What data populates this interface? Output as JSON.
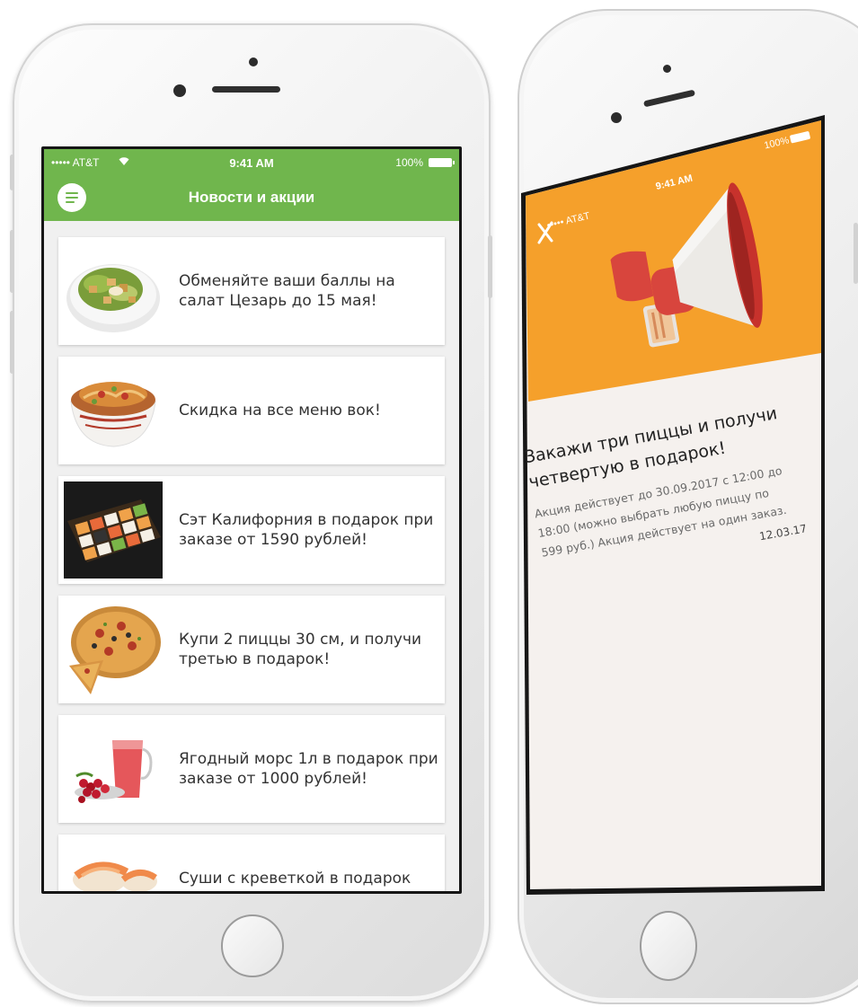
{
  "left_phone": {
    "status_bar": {
      "carrier": "••••• AT&T",
      "time": "9:41 AM",
      "battery": "100%"
    },
    "header": {
      "title": "Новости и акции"
    },
    "news": [
      {
        "text": "Обменяйте ваши баллы на салат Цезарь до 15 мая!",
        "image": "caesar-salad"
      },
      {
        "text": "Скидка на все меню вок!",
        "image": "wok-noodles"
      },
      {
        "text": "Сэт Калифорния в подарок при заказе от 1590 рублей!",
        "image": "sushi-set"
      },
      {
        "text": "Купи 2 пиццы 30 см, и получи третью в подарок!",
        "image": "pizza"
      },
      {
        "text": "Ягодный морс 1л в подарок при заказе от 1000 рублей!",
        "image": "berry-drink"
      },
      {
        "text": "Суши с креветкой в подарок",
        "image": "shrimp-sushi"
      }
    ]
  },
  "right_phone": {
    "status_bar": {
      "carrier": "••••• AT&T",
      "time": "9:41 AM",
      "battery": "100%"
    },
    "promo": {
      "title_line1": "Закажи три пиццы и получи",
      "title_line2": "четвертую в подарок!",
      "text_line1": "Акция действует до 30.09.2017 с 12:00 до",
      "text_line2": "18:00 (можно выбрать любую пиццу по",
      "text_line3": "599 руб.) Акция действует на один заказ.",
      "date": "12.03.17",
      "icon": "megaphone-icon"
    },
    "colors": {
      "banner": "#f5a02b",
      "content_bg": "#f5f1ee"
    }
  },
  "colors": {
    "header_green": "#70b64d"
  }
}
